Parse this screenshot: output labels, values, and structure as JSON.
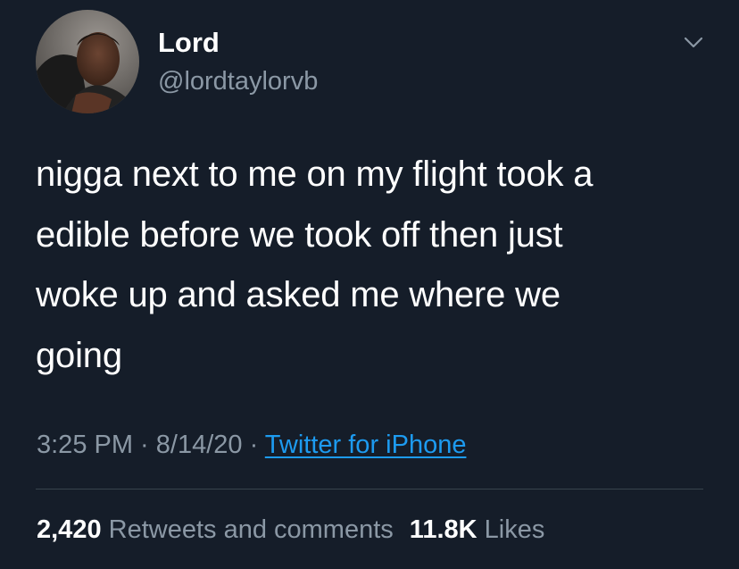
{
  "user": {
    "display_name": "Lord",
    "handle": "@lordtaylorvb"
  },
  "tweet": {
    "lines": [
      "nigga next to me on my flight took a",
      "edible before we took off then just",
      "woke up and asked me where we",
      "going"
    ]
  },
  "meta": {
    "time": "3:25 PM",
    "sep1": " · ",
    "date": "8/14/20",
    "sep2": " · ",
    "source": "Twitter for iPhone"
  },
  "stats": {
    "retweets_count": "2,420",
    "retweets_label": "Retweets and comments",
    "likes_count": "11.8K",
    "likes_label": "Likes"
  },
  "icons": {
    "more": "chevron-down-icon",
    "avatar": "profile-photo"
  },
  "colors": {
    "background": "#151d29",
    "primary_text": "#ffffff",
    "secondary_text": "#8b98a5",
    "link": "#1d9bf0",
    "divider": "#38444d"
  }
}
